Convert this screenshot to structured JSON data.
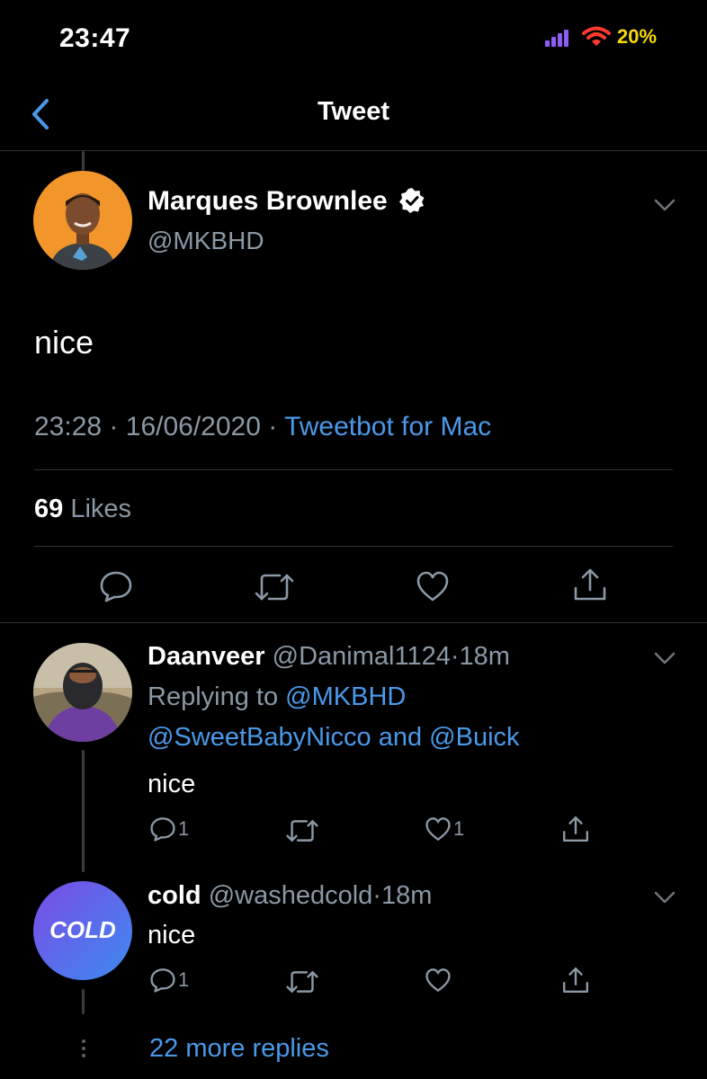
{
  "status_bar": {
    "time": "23:47",
    "battery": "20%",
    "signal_color": "#8e5cf6",
    "wifi_color": "#ff3b30",
    "battery_color": "#f5d90a"
  },
  "nav": {
    "title": "Tweet",
    "back_icon": "chevron-left-icon"
  },
  "tweet": {
    "name": "Marques Brownlee",
    "verified_icon": "verified-badge-icon",
    "handle": "@MKBHD",
    "text": "nice",
    "time": "23:28",
    "date": "16/06/2020",
    "separator": "·",
    "source": "Tweetbot for Mac",
    "likes_count": "69",
    "likes_label": "Likes",
    "actions": [
      "reply-icon",
      "retweet-icon",
      "like-icon",
      "share-icon"
    ]
  },
  "replies": [
    {
      "name": "Daanveer",
      "handle": "@Danimal1124",
      "separator": "·",
      "age": "18m",
      "replying_label": "Replying to",
      "mentions": [
        "@MKBHD",
        "@SweetBabyNicco",
        "@Buick"
      ],
      "and_label": "and",
      "text": "nice",
      "reply_count": "1",
      "like_count": "1"
    },
    {
      "name": "cold",
      "handle": "@washedcold",
      "separator": "·",
      "age": "18m",
      "avatar_text": "COLD",
      "text": "nice",
      "reply_count": "1"
    }
  ],
  "more_replies": "22 more replies",
  "colors": {
    "accent": "#4a99e9",
    "muted": "#8b98a5",
    "divider": "#2f3336"
  }
}
